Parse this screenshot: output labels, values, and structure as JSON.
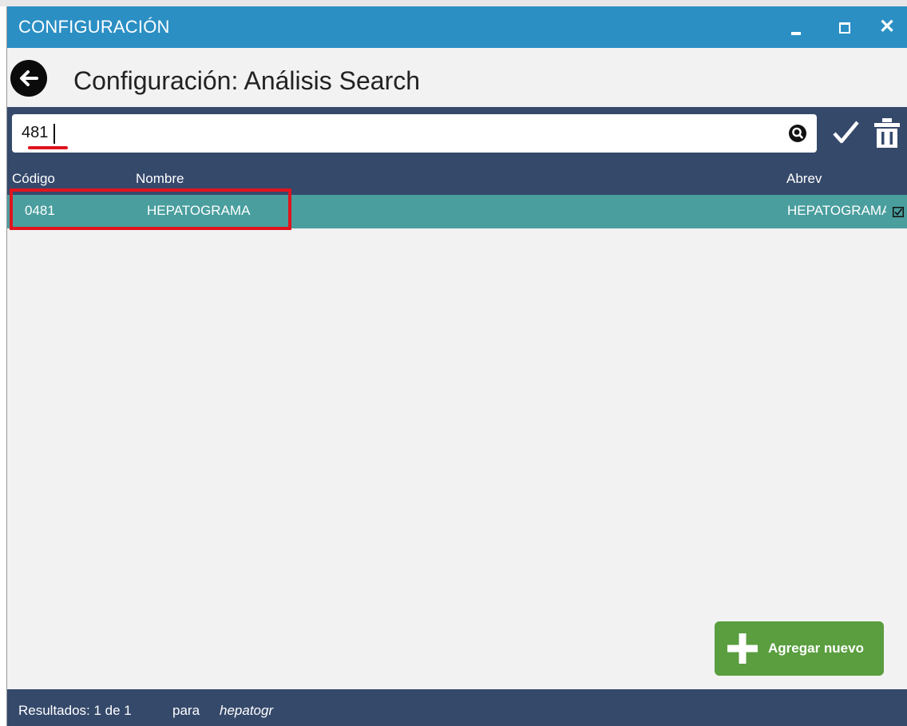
{
  "window": {
    "title": "CONFIGURACIÓN",
    "controls": {
      "minimize": "minimize-icon",
      "maximize": "maximize-icon",
      "close": "✕"
    }
  },
  "header": {
    "back_icon": "arrow-left-icon",
    "title": "Configuración: Análisis Search"
  },
  "search": {
    "value": "481",
    "placeholder": "",
    "icons": [
      "search-icon",
      "check-icon",
      "trash-icon"
    ]
  },
  "table": {
    "columns": {
      "code": "Código",
      "name": "Nombre",
      "abrev": "Abrev"
    },
    "rows": [
      {
        "code": "0481",
        "name": "HEPATOGRAMA",
        "abrev": "HEPATOGRAMA",
        "selected": true
      }
    ]
  },
  "actions": {
    "add_new": "Agregar nuevo"
  },
  "status": {
    "results": "Resultados: 1 de 1",
    "para": "para",
    "query": "hepatogr"
  },
  "colors": {
    "titlebar": "#2b8fc4",
    "toolbar": "#35496b",
    "row_selected": "#4a9e9e",
    "add_button": "#5a9e3f",
    "highlight": "#e0141e"
  }
}
